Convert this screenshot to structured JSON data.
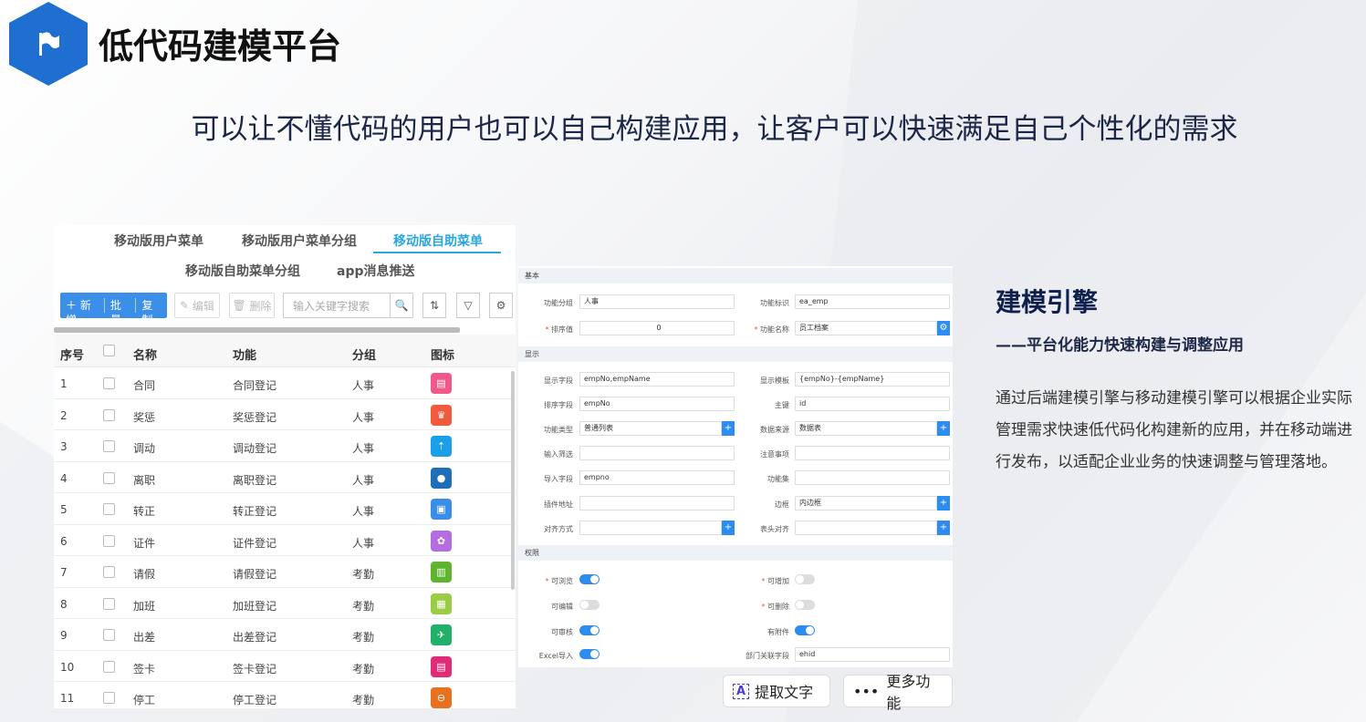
{
  "header": {
    "title": "低代码建模平台",
    "subtitle": "可以让不懂代码的用户也可以自己构建应用，让客户可以快速满足自己个性化的需求"
  },
  "tabs": [
    "移动版用户菜单",
    "移动版用户菜单分组",
    "移动版自助菜单",
    "移动版自助菜单分组",
    "app消息推送"
  ],
  "active_tab": "移动版自助菜单",
  "toolbar": {
    "add": "＋ 新增",
    "batch": "批量",
    "copy": "复制",
    "edit": "编辑",
    "delete": "删除",
    "search_placeholder": "输入关键字搜索"
  },
  "table": {
    "headers": [
      "序号",
      "名称",
      "功能",
      "分组",
      "图标"
    ],
    "rows": [
      {
        "no": "1",
        "name": "合同",
        "func": "合同登记",
        "group": "人事",
        "icon_color": "#f05a8a",
        "icon": "contract-icon"
      },
      {
        "no": "2",
        "name": "奖惩",
        "func": "奖惩登记",
        "group": "人事",
        "icon_color": "#f15a3b",
        "icon": "award-icon"
      },
      {
        "no": "3",
        "name": "调动",
        "func": "调动登记",
        "group": "人事",
        "icon_color": "#1aa0e8",
        "icon": "transfer-icon"
      },
      {
        "no": "4",
        "name": "离职",
        "func": "离职登记",
        "group": "人事",
        "icon_color": "#1e6fb8",
        "icon": "person-icon"
      },
      {
        "no": "5",
        "name": "转正",
        "func": "转正登记",
        "group": "人事",
        "icon_color": "#3a8ee8",
        "icon": "lock-icon"
      },
      {
        "no": "6",
        "name": "证件",
        "func": "证件登记",
        "group": "人事",
        "icon_color": "#b46ce0",
        "icon": "badge-icon"
      },
      {
        "no": "7",
        "name": "请假",
        "func": "请假登记",
        "group": "考勤",
        "icon_color": "#5db52e",
        "icon": "clipboard-icon"
      },
      {
        "no": "8",
        "name": "加班",
        "func": "加班登记",
        "group": "考勤",
        "icon_color": "#9acc44",
        "icon": "board-icon"
      },
      {
        "no": "9",
        "name": "出差",
        "func": "出差登记",
        "group": "考勤",
        "icon_color": "#21b06a",
        "icon": "plane-icon"
      },
      {
        "no": "10",
        "name": "签卡",
        "func": "签卡登记",
        "group": "考勤",
        "icon_color": "#e02c78",
        "icon": "card-icon"
      },
      {
        "no": "11",
        "name": "停工",
        "func": "停工登记",
        "group": "考勤",
        "icon_color": "#e6711e",
        "icon": "stop-icon"
      }
    ]
  },
  "form": {
    "sections": [
      "基本",
      "显示",
      "权限"
    ],
    "fields": {
      "func_group": {
        "label": "功能分组",
        "value": "人事"
      },
      "func_id": {
        "label": "功能标识",
        "value": "ea_emp"
      },
      "sort": {
        "label": "排序值",
        "value": "0"
      },
      "func_name": {
        "label": "功能名称",
        "value": "员工档案"
      },
      "show_field": {
        "label": "显示字段",
        "value": "empNo,empName"
      },
      "show_template": {
        "label": "显示模板",
        "value": "{empNo}-{empName}"
      },
      "sort_field": {
        "label": "排序字段",
        "value": "empNo"
      },
      "primary_key": {
        "label": "主键",
        "value": "id"
      },
      "func_type": {
        "label": "功能类型",
        "value": "普通列表"
      },
      "data_source": {
        "label": "数据来源",
        "value": "数据表"
      },
      "input_filter": {
        "label": "输入筛选",
        "value": ""
      },
      "notes": {
        "label": "注意事项",
        "value": ""
      },
      "import_field": {
        "label": "导入字段",
        "value": "empno"
      },
      "func_set": {
        "label": "功能集",
        "value": ""
      },
      "plugin_addr": {
        "label": "插件地址",
        "value": ""
      },
      "border": {
        "label": "边框",
        "value": "内边框"
      },
      "align": {
        "label": "对齐方式",
        "value": ""
      },
      "header_align": {
        "label": "表头对齐",
        "value": ""
      },
      "can_view": {
        "label": "可浏览",
        "on": true
      },
      "can_add": {
        "label": "可增加",
        "on": false
      },
      "can_edit": {
        "label": "可编辑",
        "on": false
      },
      "can_delete": {
        "label": "可删除",
        "on": false
      },
      "can_audit": {
        "label": "可审核",
        "on": true
      },
      "has_attach": {
        "label": "有附件",
        "on": true
      },
      "excel_import": {
        "label": "Excel导入",
        "on": true
      },
      "dept_field": {
        "label": "部门关联字段",
        "value": "ehid"
      }
    }
  },
  "ocr": {
    "extract": "提取文字",
    "more": "更多功能"
  },
  "right": {
    "heading": "建模引擎",
    "subheading": "——平台化能力快速构建与调整应用",
    "body": "通过后端建模引擎与移动建模引擎可以根据企业实际管理需求快速低代码化构建新的应用，并在移动端进行发布，以适配企业业务的快速调整与管理落地。"
  }
}
